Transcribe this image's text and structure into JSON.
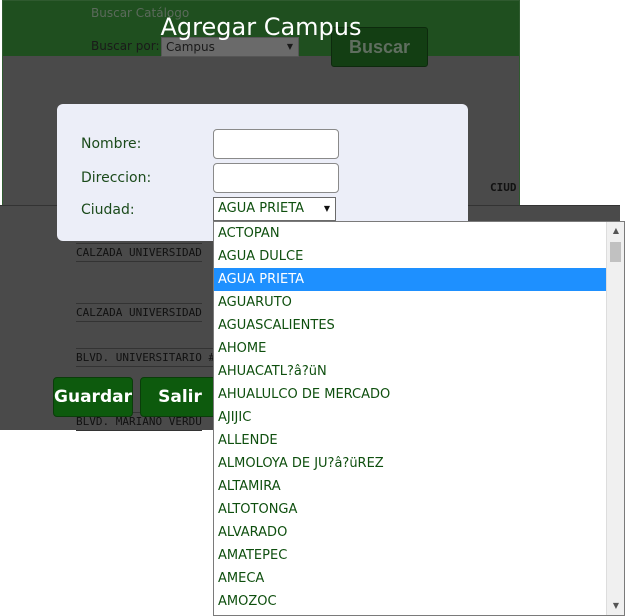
{
  "background": {
    "catalog_label": "Buscar Catálogo",
    "search_by_label": "Buscar por:",
    "search_by_value": "Campus",
    "search_button": "Buscar",
    "column_header": "CIUD",
    "rows": [
      "CALZADA UNIVERSIDAD",
      "CALZADA UNIVERSIDAD",
      "BLVD. UNIVERSITARIO #",
      "BLVD. MARIANO VERDU"
    ]
  },
  "modal": {
    "title": "Agregar Campus",
    "fields": {
      "nombre_label": "Nombre:",
      "nombre_value": "",
      "direccion_label": "Direccion:",
      "direccion_value": "",
      "ciudad_label": "Ciudad:",
      "ciudad_value": "AGUA PRIETA"
    },
    "buttons": {
      "save": "Guardar",
      "exit": "Salir"
    }
  },
  "dropdown": {
    "selected": "AGUA PRIETA",
    "options": [
      "ACTOPAN",
      "AGUA DULCE",
      "AGUA PRIETA",
      "AGUARUTO",
      "AGUASCALIENTES",
      "AHOME",
      "AHUACATL?â?üN",
      "AHUALULCO DE MERCADO",
      "AJIJIC",
      "ALLENDE",
      "ALMOLOYA DE JU?â?üREZ",
      "ALTAMIRA",
      "ALTOTONGA",
      "ALVARADO",
      "AMATEPEC",
      "AMECA",
      "AMOZOC"
    ]
  },
  "colors": {
    "accent": "#0d5a0d",
    "selection": "#1e90ff",
    "modal_bg": "#eceef8"
  }
}
